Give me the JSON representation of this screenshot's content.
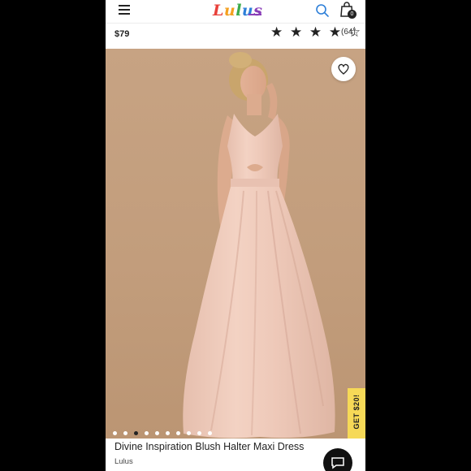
{
  "header": {
    "logo_text": [
      "L",
      "u",
      "l",
      "u",
      "s"
    ],
    "cart_count": "0",
    "icons": [
      "hamburger-menu-icon",
      "search-icon",
      "shopping-bag-icon"
    ]
  },
  "product": {
    "price": "$79",
    "rating": {
      "stars": "★ ★ ★ ★ ☆",
      "value": 4,
      "max": 5,
      "count": "(64)"
    },
    "title": "Divine Inspiration Blush Halter Maxi Dress",
    "brand": "Lulus",
    "image_description": "Model in blush pink halter maxi dress",
    "gallery": {
      "total_images": 10,
      "active_index": 2
    }
  },
  "promo": {
    "label": "GET $20!"
  },
  "colors": {
    "background": "#c4a07f",
    "dress": "#efcbbd",
    "promo": "#f6d957",
    "text": "#222222"
  }
}
